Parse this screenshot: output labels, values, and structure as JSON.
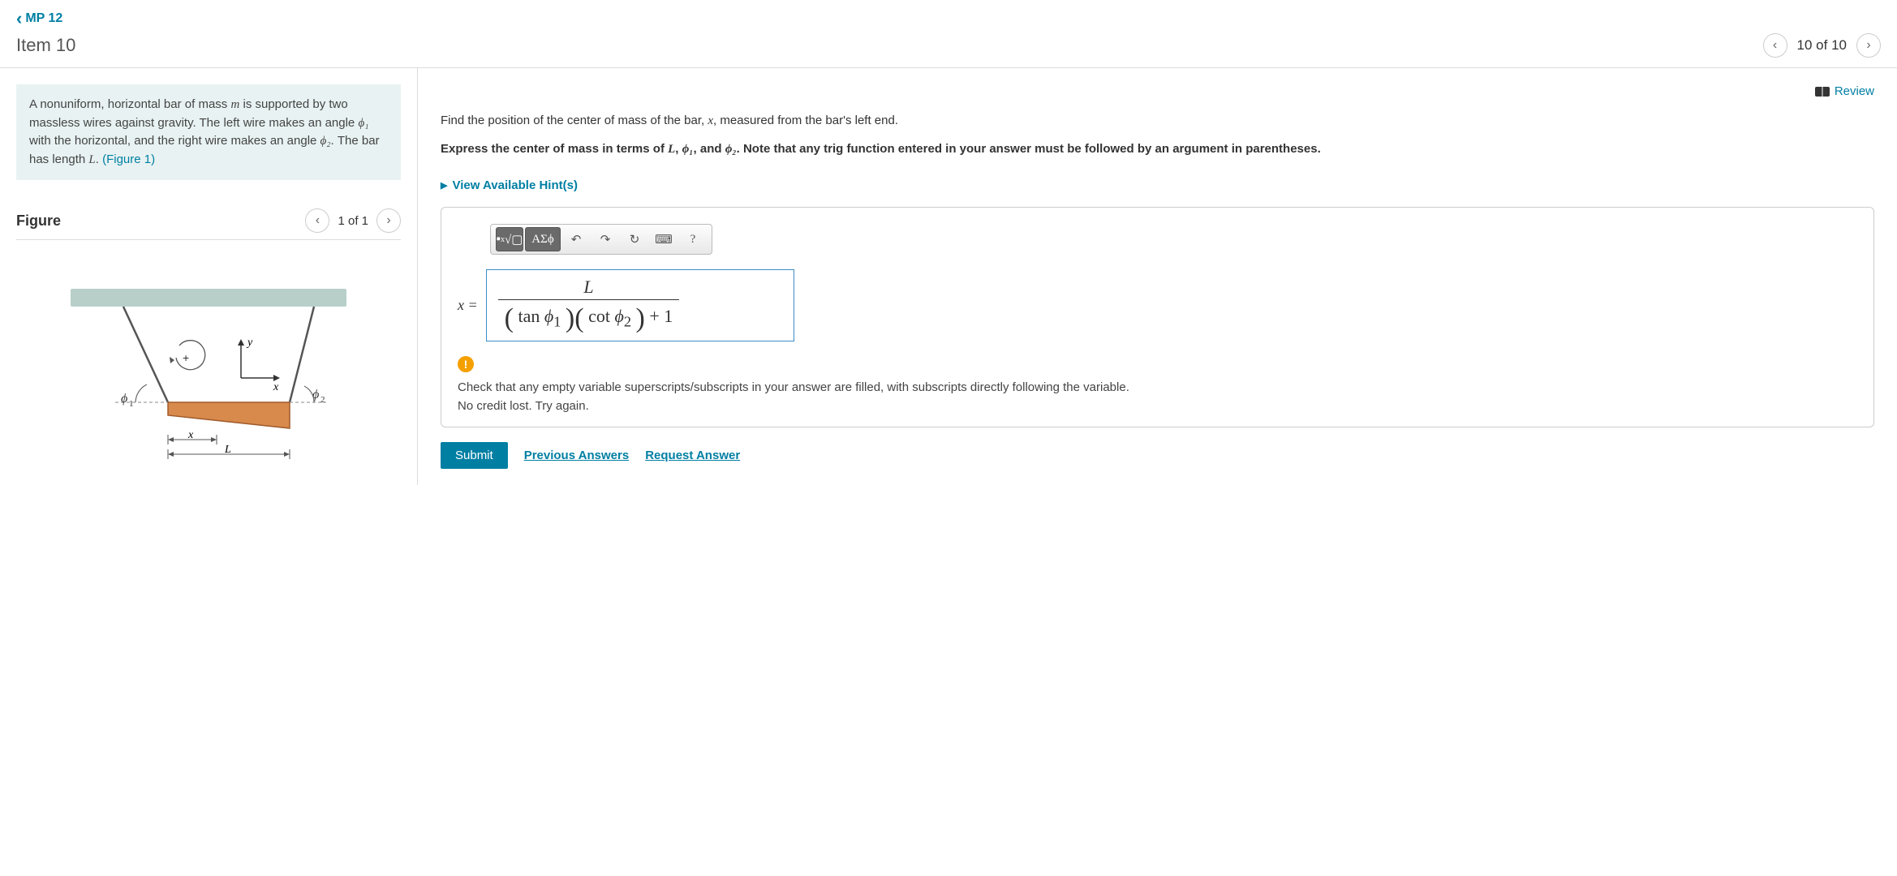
{
  "header": {
    "back_label": "MP 12",
    "item_title": "Item 10",
    "position": "10 of 10"
  },
  "problem": {
    "text_prefix": "A nonuniform, horizontal bar of mass ",
    "mass_sym": "m",
    "text_mid1": " is supported by two massless wires against gravity. The left wire makes an angle ",
    "phi1": "ϕ₁",
    "text_mid2": " with the horizontal, and the right wire makes an angle ",
    "phi2": "ϕ₂",
    "text_mid3": ". The bar has length ",
    "L_sym": "L",
    "text_suffix": ". ",
    "figure_link": "(Figure 1)"
  },
  "figure": {
    "title": "Figure",
    "position": "1 of 1",
    "labels": {
      "phi1": "ϕ₁",
      "phi2": "ϕ₂",
      "x_axis": "x",
      "y_axis": "y",
      "x_dim": "x",
      "L_dim": "L"
    }
  },
  "right": {
    "review": "Review",
    "prompt_1_a": "Find the position of the center of mass of the bar, ",
    "prompt_1_x": "x",
    "prompt_1_b": ", measured from the bar's left end.",
    "prompt_2_a": "Express the center of mass in terms of ",
    "prompt_2_L": "L",
    "prompt_2_sep1": ", ",
    "prompt_2_phi1": "ϕ₁",
    "prompt_2_sep2": ", and ",
    "prompt_2_phi2": "ϕ₂",
    "prompt_2_b": ".  Note that any trig function entered in your answer must be followed by an argument in parentheses.",
    "hints": "View Available Hint(s)",
    "toolbar": {
      "templates": "√▢",
      "greek": "ΑΣϕ",
      "undo": "↶",
      "redo": "↷",
      "reset": "↻",
      "keyboard": "⌨",
      "help": "?"
    },
    "answer": {
      "label": "x =",
      "numerator": "L",
      "den_tan": "tan",
      "den_phi1": "ϕ",
      "den_phi1_sub": "1",
      "den_cot": "cot",
      "den_phi2": "ϕ",
      "den_phi2_sub": "2",
      "den_tail": " + 1"
    },
    "feedback": {
      "line1": "Check that any empty variable superscripts/subscripts in your answer are filled, with subscripts directly following the variable.",
      "line2": "No credit lost. Try again."
    },
    "actions": {
      "submit": "Submit",
      "prev": "Previous Answers",
      "request": "Request Answer"
    }
  }
}
